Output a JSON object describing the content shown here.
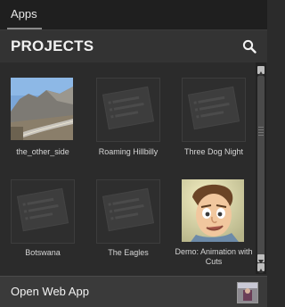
{
  "topbar": {
    "tab_label": "Apps"
  },
  "header": {
    "title": "PROJECTS",
    "search_icon": "search-icon"
  },
  "projects": [
    {
      "label": "the_other_side",
      "thumb": "photo-mountain-road"
    },
    {
      "label": "Roaming Hillbilly",
      "thumb": "placeholder-doc"
    },
    {
      "label": "Three Dog Night",
      "thumb": "placeholder-doc"
    },
    {
      "label": "Botswana",
      "thumb": "placeholder-doc"
    },
    {
      "label": "The Eagles",
      "thumb": "placeholder-doc"
    },
    {
      "label": "Demo: Animation with Cuts",
      "thumb": "cartoon-character"
    }
  ],
  "footer": {
    "label": "Open Web App",
    "avatar_icon": "app-avatar-icon"
  },
  "colors": {
    "background": "#2b2b2b",
    "header": "#333333",
    "footer": "#3a3a3a"
  }
}
